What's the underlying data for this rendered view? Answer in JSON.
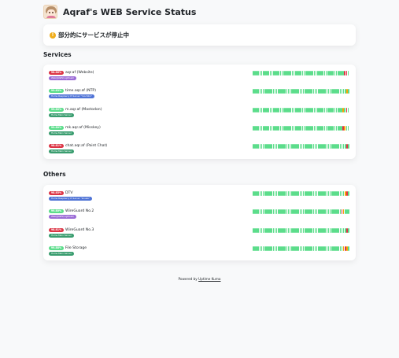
{
  "header": {
    "title": "Aqraf's WEB Service Status",
    "logo_icon": "avatar-logo-icon"
  },
  "overall_status": {
    "icon": "warning-icon",
    "icon_glyph": "!",
    "text": "部分的にサービスが停止中",
    "color": "#f0ad1b"
  },
  "colors": {
    "up": "#5cdd8b",
    "down": "#dc3545",
    "pending": "#f8a306"
  },
  "groups": [
    {
      "name": "Services",
      "monitors": [
        {
          "uptime": "98.86%",
          "level": "low",
          "name": "aqr.af (Website)",
          "tag": "Web@AWS(Lightsail)",
          "tag_color": "#9b6bd6",
          "beats": "uuuuuuuuuuuuuuuuuuuuuuuuuuuuuuuuuuuuuuuuuuuuuuuuuuuuuuddu"
        },
        {
          "uptime": "99.83%",
          "level": "high",
          "name": "time.aqr.af (NTP)",
          "tag": "Home Raspberry Pi Server \"mochiko\"",
          "tag_color": "#4f73d6",
          "beats": "uuuuuuuuuuuuuuuuuuuuuuuuuuuuuuuuuuuuuuuuuuuuuuuuuuuuuuuupu"
        },
        {
          "uptime": "99.80%",
          "level": "high",
          "name": "m.aqr.af (Mastodon)",
          "tag": "Home Main Server",
          "tag_color": "#3a9d6f",
          "beats": "uuuuuuuuuuuuuuuuuuuuuuuuuuuuuuuuuuuuuuuuuuuuuuuuuuuuupudu"
        },
        {
          "uptime": "99.80%",
          "level": "high",
          "name": "mk.aqr.af (Misskey)",
          "tag": "Home Main Server",
          "tag_color": "#3a9d6f",
          "beats": "uuuuuuuuuuuuuuuuuuuuuuuuuuuuuuuuuuuuuuuuuuuuuuuuuuuuudpuu"
        },
        {
          "uptime": "98.81%",
          "level": "low",
          "name": "chat.aqr.af (Paint Chat)",
          "tag": "Home Main Server",
          "tag_color": "#3a9d6f",
          "beats": "uuuuuuuuuuuuuuuuuuuuuuuuuuuuuuuuuuuuuuuuuuuuuuuuuuuuuuuudu"
        }
      ]
    },
    {
      "name": "Others",
      "monitors": [
        {
          "uptime": "98.85%",
          "level": "low",
          "name": "DTV",
          "tag": "Home Raspberry Pi Server \"kinako\"",
          "tag_color": "#4f73d6",
          "beats": "uuuuuuuuuuuuuuuuuuuuuuuuuuuuuuuuuuuuuuuuuuuuuuuuuuuuuuupdu"
        },
        {
          "uptime": "99.80%",
          "level": "high",
          "name": "WireGuard No.2",
          "tag": "Web@AWS(Lightsail)",
          "tag_color": "#9b6bd6",
          "beats": "uuuuuuuuuuuuuuuuuuuuuuuuuuuuuuuuuuuuuuuuuuuuuuuuuuuuudpuuu"
        },
        {
          "uptime": "98.81%",
          "level": "low",
          "name": "WireGuard No.3",
          "tag": "Home Main Server",
          "tag_color": "#3a9d6f",
          "beats": "uuuuuuuuuuuuuuuuuuuuuuuuuuuuuuuuuuuuuuuuuuuuuuuuuuuuuuuudu"
        },
        {
          "uptime": "99.88%",
          "level": "high",
          "name": "File Storage",
          "tag": "Home Main Server",
          "tag_color": "#3a9d6f",
          "beats": "uuuuuuuuuuuuuuuuuuuuuuuuuuuuuuuuuuuuuuuuuuuuuuuuuuuuuupdpu"
        }
      ]
    }
  ],
  "footer": {
    "prefix": "Powered by",
    "link": "Uptime Kuma"
  }
}
